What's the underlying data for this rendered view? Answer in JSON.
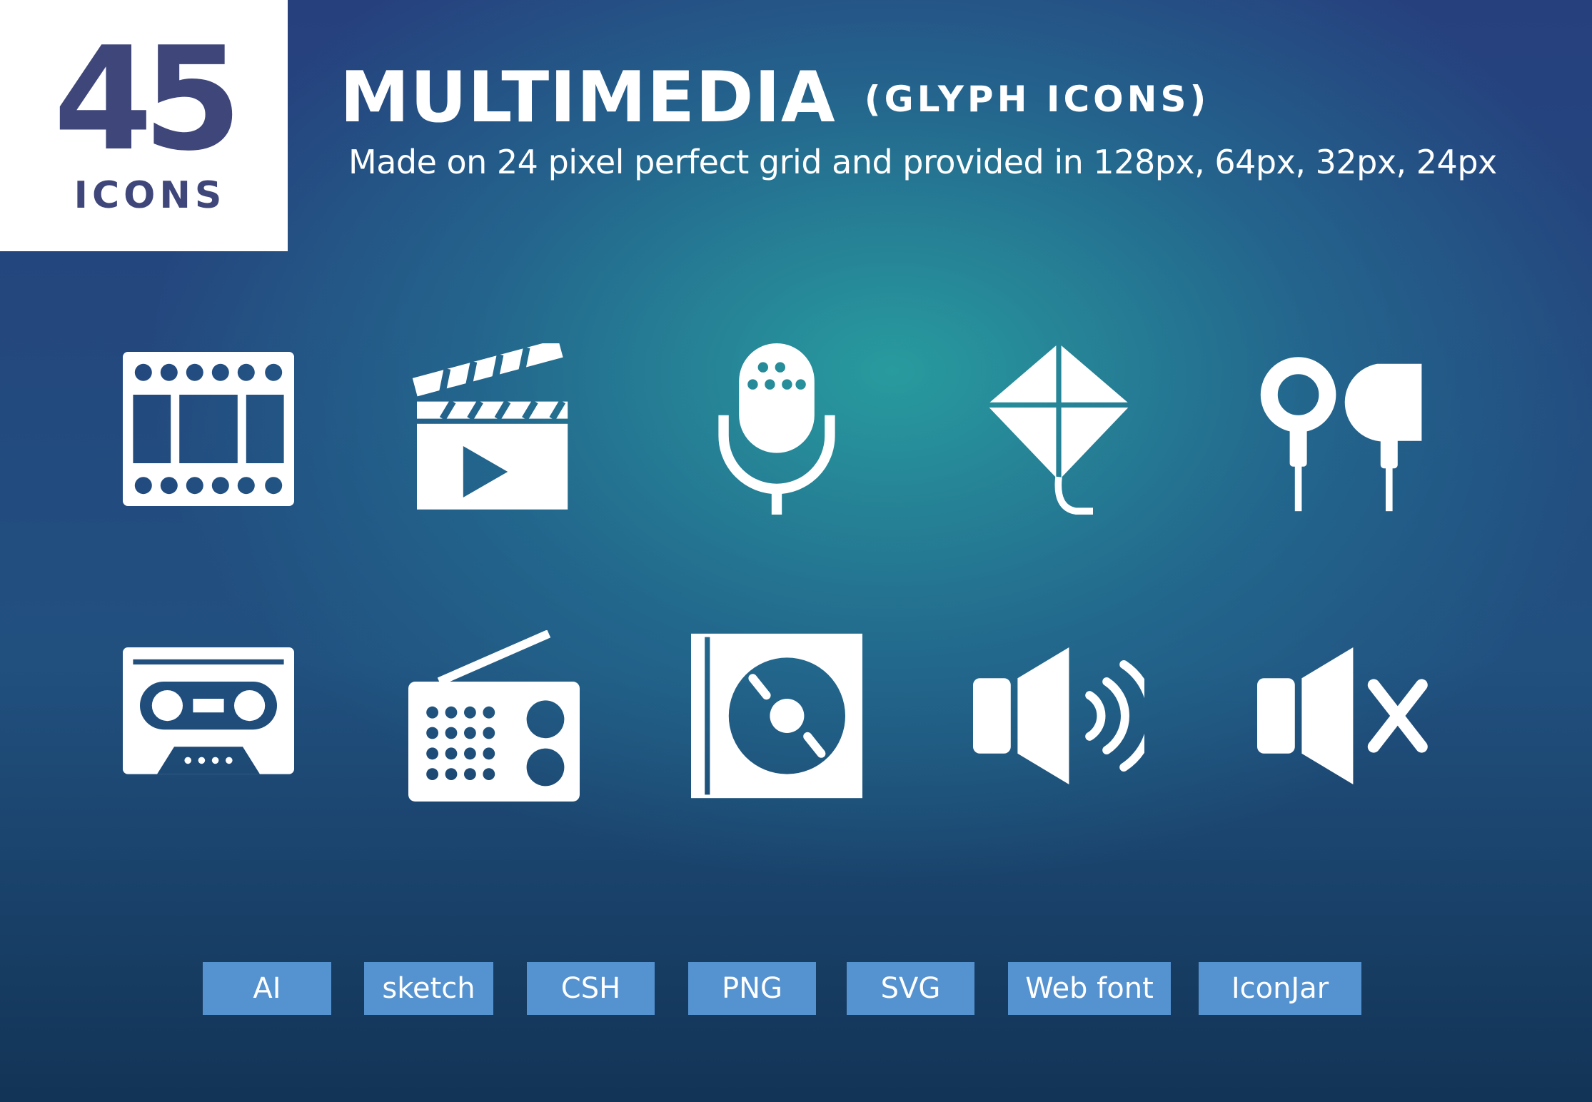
{
  "badge": {
    "count": "45",
    "label": "ICONS"
  },
  "header": {
    "title": "MULTIMEDIA",
    "title_suffix": "(GLYPH ICONS)",
    "subtitle": "Made on 24 pixel perfect grid and provided in 128px, 64px, 32px, 24px"
  },
  "icons": [
    "film-strip-icon",
    "clapperboard-icon",
    "microphone-icon",
    "kite-icon",
    "earphones-icon",
    "cassette-player-icon",
    "radio-icon",
    "turntable-icon",
    "speaker-volume-icon",
    "speaker-mute-icon"
  ],
  "formats": [
    "AI",
    "sketch",
    "CSH",
    "PNG",
    "SVG",
    "Web font",
    "IconJar"
  ],
  "colors": {
    "badge_text": "#3f4679",
    "format_bg": "#5592d0",
    "icon": "#ffffff"
  }
}
